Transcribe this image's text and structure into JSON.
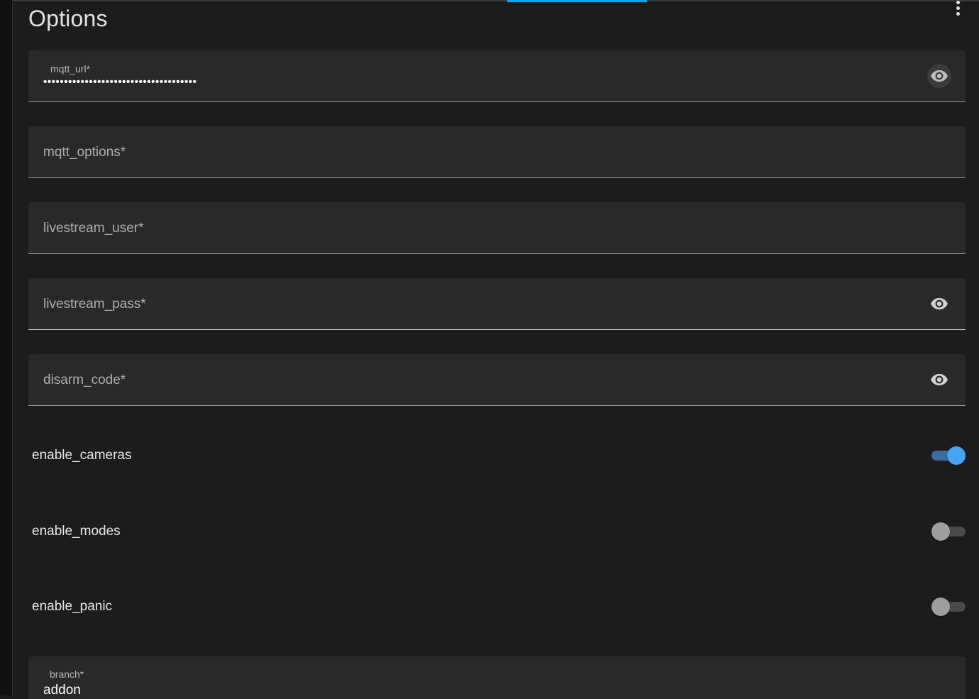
{
  "page": {
    "title": "Options"
  },
  "colors": {
    "background": "#1c1c1c",
    "field_background": "#292929",
    "accent": "#03a9f4",
    "switch_on_thumb": "#44a4ef",
    "switch_off_thumb": "#9e9e9e"
  },
  "fields": {
    "mqtt_url": {
      "label": "mqtt_url*",
      "masked_value": "•••••••••••••••••••••••••••••••••••••",
      "icon": "eye-icon"
    },
    "mqtt_options": {
      "placeholder": "mqtt_options*"
    },
    "livestream_user": {
      "placeholder": "livestream_user*"
    },
    "livestream_pass": {
      "placeholder": "livestream_pass*",
      "icon": "eye-icon"
    },
    "disarm_code": {
      "placeholder": "disarm_code*",
      "icon": "eye-icon"
    },
    "branch": {
      "label": "branch*",
      "value": "addon"
    }
  },
  "toggles": {
    "enable_cameras": {
      "label": "enable_cameras",
      "on": true
    },
    "enable_modes": {
      "label": "enable_modes",
      "on": false
    },
    "enable_panic": {
      "label": "enable_panic",
      "on": false
    }
  },
  "icons": {
    "overflow_menu": "more-vertical-icon"
  }
}
